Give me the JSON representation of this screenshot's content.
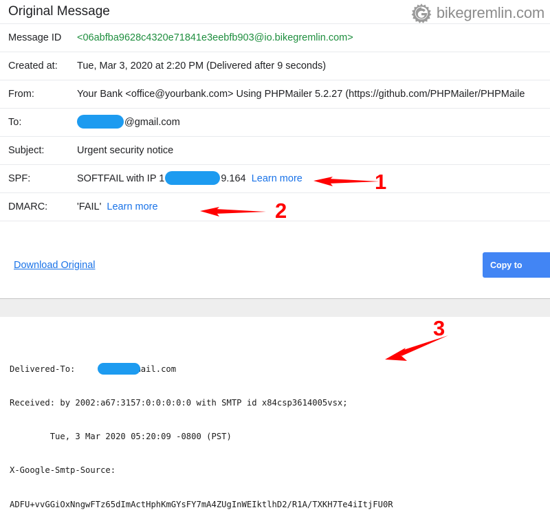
{
  "watermark": {
    "icon": "gear-g-logo-icon",
    "text": "bikegremlin.com",
    "color": "#8c8c8c"
  },
  "header": {
    "title": "Original Message"
  },
  "colors": {
    "link": "#1a73e8",
    "message_id": "#1e8e3e",
    "button": "#4285f4",
    "annotation": "#ff0000",
    "redaction": "#1d9bf0"
  },
  "table": {
    "rows": [
      {
        "label": "Message ID",
        "value": "<06abfba9628c4320e71841e3eebfb903@io.bikegremlin.com>",
        "style": "message-id"
      },
      {
        "label": "Created at:",
        "value": "Tue, Mar 3, 2020 at 2:20 PM (Delivered after 9 seconds)",
        "style": "plain"
      },
      {
        "label": "From:",
        "value": "Your Bank <office@yourbank.com> Using PHPMailer 5.2.27 (https://github.com/PHPMailer/PHPMaile",
        "style": "plain-clipped"
      },
      {
        "label": "To:",
        "value_suffix": "@gmail.com",
        "style": "redacted"
      },
      {
        "label": "Subject:",
        "value": "Urgent security notice",
        "style": "plain"
      },
      {
        "label": "SPF:",
        "value_prefix": "SOFTFAIL with IP 1",
        "value_suffix": "9.164",
        "link": "Learn more",
        "style": "redacted-link"
      },
      {
        "label": "DMARC:",
        "value_prefix": "'FAIL'",
        "link": "Learn more",
        "style": "value-link"
      }
    ]
  },
  "actions": {
    "download_label": "Download Original",
    "copy_label": "Copy to clipboard"
  },
  "raw_source": {
    "lines": [
      {
        "prefix": "Delivered-To: ",
        "redacted": true,
        "suffix": "@gmail.com"
      },
      {
        "text": "Received: by 2002:a67:3157:0:0:0:0:0 with SMTP id x84csp3614005vsx;"
      },
      {
        "text": "        Tue, 3 Mar 2020 05:20:09 -0800 (PST)"
      },
      {
        "text": "X-Google-Smtp-Source:"
      },
      {
        "text": "ADFU+vvGGiOxNngwFTz65dImActHphKmGYsFY7mA4ZUgInWEIktlhD2/R1A/TXKH7Te4iItjFU0R"
      }
    ]
  },
  "annotations": [
    {
      "number": "1",
      "target": "spf-row"
    },
    {
      "number": "2",
      "target": "dmarc-row"
    },
    {
      "number": "3",
      "target": "received-line"
    }
  ]
}
